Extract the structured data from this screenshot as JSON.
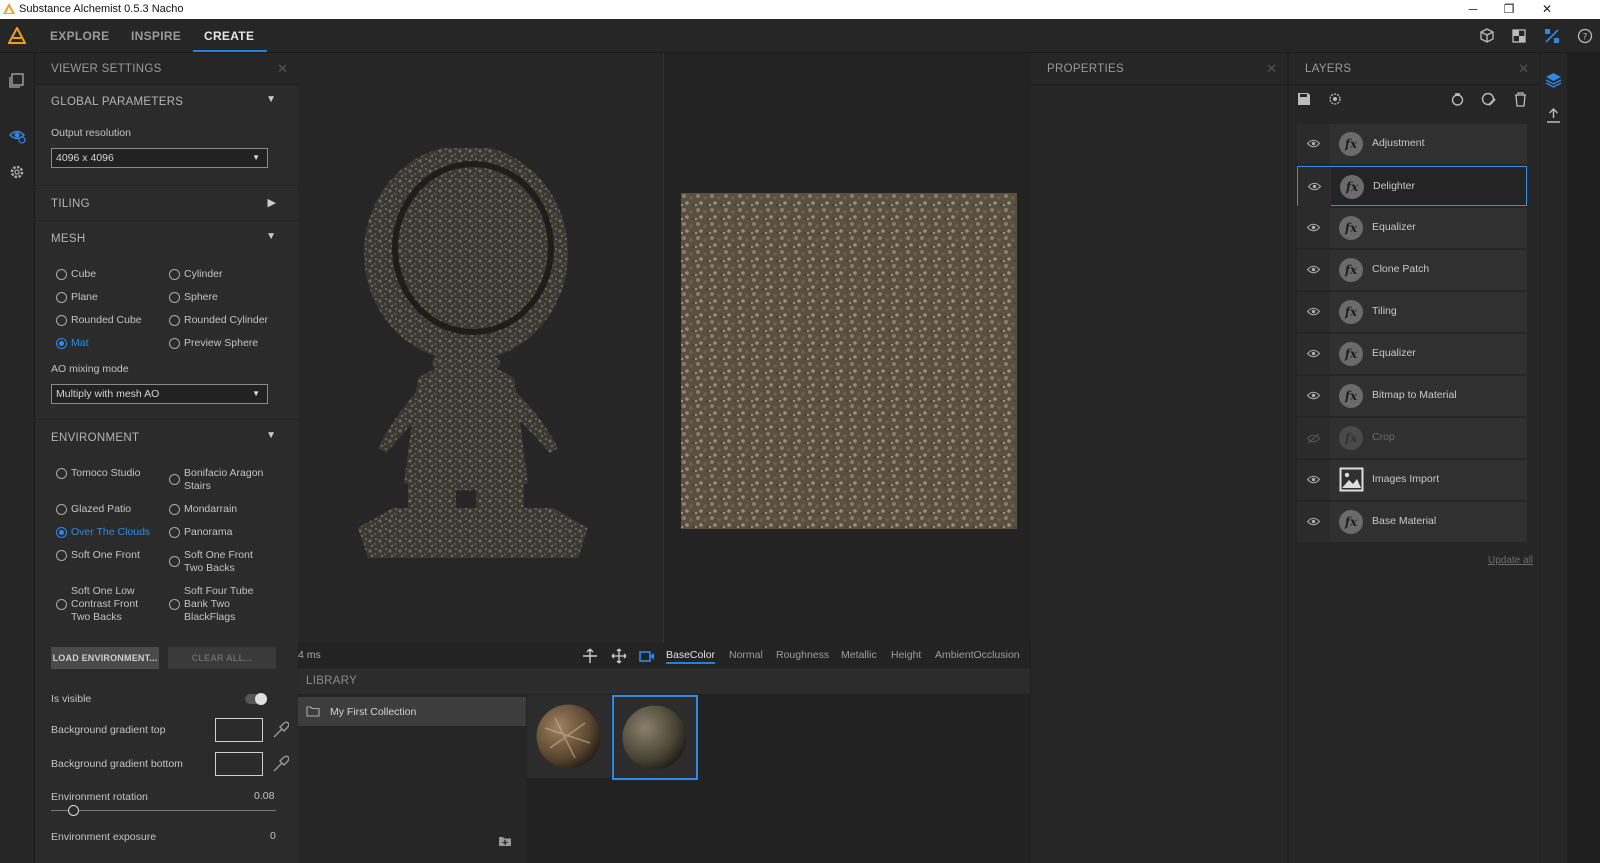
{
  "window": {
    "title": "Substance Alchemist 0.5.3 Nacho",
    "minimize": "─",
    "restore": "❐",
    "close": "✕"
  },
  "nav": {
    "tabs": [
      {
        "label": "EXPLORE"
      },
      {
        "label": "INSPIRE"
      },
      {
        "label": "CREATE"
      }
    ],
    "active": "CREATE"
  },
  "viewer_settings": {
    "title": "VIEWER SETTINGS",
    "global": {
      "title": "GLOBAL PARAMETERS",
      "output_label": "Output resolution",
      "output_value": "4096 x 4096"
    },
    "tiling": {
      "title": "TILING"
    },
    "mesh": {
      "title": "MESH",
      "options": [
        "Cube",
        "Cylinder",
        "Plane",
        "Sphere",
        "Rounded Cube",
        "Rounded Cylinder",
        "Mat",
        "Preview Sphere"
      ],
      "selected": "Mat",
      "ao_label": "AO mixing mode",
      "ao_value": "Multiply with mesh AO"
    },
    "environment": {
      "title": "ENVIRONMENT",
      "options": [
        "Tomoco Studio",
        "Bonifacio Aragon Stairs",
        "Glazed Patio",
        "Mondarrain",
        "Over The Clouds",
        "Panorama",
        "Soft One Front",
        "Soft One Front Two Backs",
        "Soft One Low Contrast Front Two Backs",
        "Soft Four Tube Bank Two BlackFlags"
      ],
      "selected": "Over The Clouds",
      "load_button": "LOAD ENVIRONMENT...",
      "clear_button": "CLEAR ALL...",
      "is_visible_label": "Is visible",
      "is_visible": false,
      "bg_top_label": "Background gradient top",
      "bg_bottom_label": "Background gradient bottom",
      "rotation_label": "Environment rotation",
      "rotation_value": "0.08",
      "exposure_label": "Environment exposure",
      "exposure_value": "0"
    }
  },
  "viewport": {
    "timing": "4 ms",
    "channels": [
      "BaseColor",
      "Normal",
      "Roughness",
      "Metallic",
      "Height",
      "AmbientOcclusion"
    ],
    "active_channel": "BaseColor"
  },
  "library": {
    "title": "LIBRARY",
    "collection": "My First Collection"
  },
  "properties": {
    "title": "PROPERTIES"
  },
  "layers": {
    "title": "LAYERS",
    "items": [
      {
        "name": "Adjustment",
        "icon": "fx-icon",
        "visible": true
      },
      {
        "name": "Delighter",
        "icon": "fx-icon",
        "visible": true,
        "selected": true
      },
      {
        "name": "Equalizer",
        "icon": "fx-icon",
        "visible": true
      },
      {
        "name": "Clone Patch",
        "icon": "fx-icon",
        "visible": true
      },
      {
        "name": "Tiling",
        "icon": "fx-icon",
        "visible": true
      },
      {
        "name": "Equalizer",
        "icon": "fx-icon",
        "visible": true
      },
      {
        "name": "Bitmap to Material",
        "icon": "fx-icon",
        "visible": true
      },
      {
        "name": "Crop",
        "icon": "fx-icon",
        "visible": false
      },
      {
        "name": "Images Import",
        "icon": "image-icon",
        "visible": true
      },
      {
        "name": "Base Material",
        "icon": "fx-icon",
        "visible": true
      }
    ],
    "update_all": "Update all"
  },
  "colors": {
    "accent": "#2a7fd4",
    "panel": "#2b2b2b",
    "background": "#1f1f1f"
  }
}
